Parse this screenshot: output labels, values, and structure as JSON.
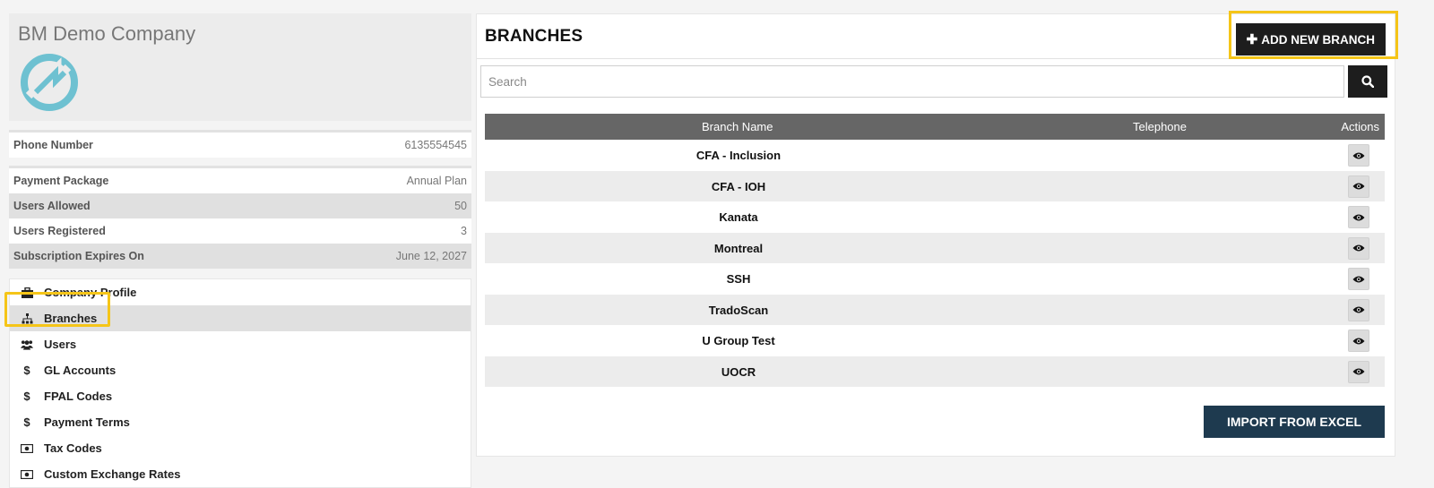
{
  "company": {
    "name": "BM Demo Company",
    "logo_icon": "company-logo-icon",
    "logo_color": "#6ec1d1"
  },
  "info": {
    "phone_label": "Phone Number",
    "phone_value": "6135554545",
    "package_label": "Payment Package",
    "package_value": "Annual Plan",
    "users_allowed_label": "Users Allowed",
    "users_allowed_value": "50",
    "users_registered_label": "Users Registered",
    "users_registered_value": "3",
    "expires_label": "Subscription Expires On",
    "expires_value": "June 12, 2027"
  },
  "nav": {
    "items": [
      {
        "label": "Company Profile",
        "icon": "briefcase-icon"
      },
      {
        "label": "Branches",
        "icon": "sitemap-icon"
      },
      {
        "label": "Users",
        "icon": "users-icon"
      },
      {
        "label": "GL Accounts",
        "icon": "dollar-icon"
      },
      {
        "label": "FPAL Codes",
        "icon": "dollar-icon"
      },
      {
        "label": "Payment Terms",
        "icon": "dollar-icon"
      },
      {
        "label": "Tax Codes",
        "icon": "money-icon"
      },
      {
        "label": "Custom Exchange Rates",
        "icon": "money-icon"
      }
    ],
    "active": "Branches"
  },
  "panel": {
    "title": "BRANCHES",
    "add_button_label": "ADD NEW BRANCH",
    "search_placeholder": "Search",
    "import_button_label": "IMPORT FROM EXCEL"
  },
  "table": {
    "headers": {
      "name": "Branch Name",
      "telephone": "Telephone",
      "actions": "Actions"
    },
    "rows": [
      {
        "name": "CFA - Inclusion",
        "telephone": ""
      },
      {
        "name": "CFA - IOH",
        "telephone": ""
      },
      {
        "name": "Kanata",
        "telephone": ""
      },
      {
        "name": "Montreal",
        "telephone": ""
      },
      {
        "name": "SSH",
        "telephone": ""
      },
      {
        "name": "TradoScan",
        "telephone": ""
      },
      {
        "name": "U Group Test",
        "telephone": ""
      },
      {
        "name": "UOCR",
        "telephone": ""
      }
    ]
  },
  "colors": {
    "highlight": "#f5c518",
    "import_button": "#1e3a4f",
    "header_bg": "#666666"
  }
}
